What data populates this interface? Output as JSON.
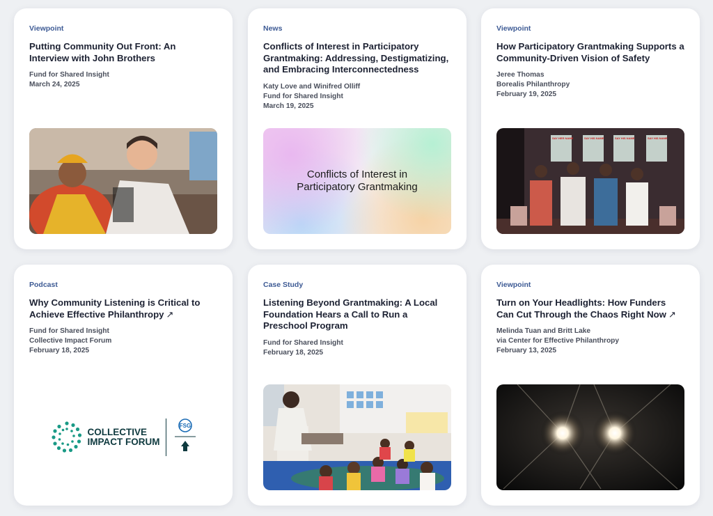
{
  "cards": [
    {
      "category": "Viewpoint",
      "title": "Putting Community Out Front: An Interview with John Brothers",
      "external": "",
      "meta": [
        "Fund for Shared Insight",
        "March 24, 2025"
      ]
    },
    {
      "category": "News",
      "title": "Conflicts of Interest in Participatory Grantmaking: Addressing, Destigmatizing, and Embracing Interconnectedness",
      "external": "",
      "meta": [
        "Katy Love and Winifred Olliff",
        "Fund for Shared Insight",
        "March 19, 2025"
      ],
      "image_text": "Conflicts of Interest in Participatory Grantmaking"
    },
    {
      "category": "Viewpoint",
      "title": "How Participatory Grantmaking Supports a Community-Driven Vision of Safety",
      "external": "",
      "meta": [
        "Jeree Thomas",
        "Borealis Philanthropy",
        "February 19, 2025"
      ],
      "poster_text": [
        "SAY HER NAME",
        "SAY HIS NAME",
        "SAY HIS NAME",
        "SAY HIS NAME"
      ]
    },
    {
      "category": "Podcast",
      "title": "Why Community Listening is Critical to Achieve Effective Philanthropy",
      "external": "↗",
      "meta": [
        "Fund for Shared Insight",
        "Collective Impact Forum",
        "February 18, 2025"
      ],
      "logo": {
        "line1": "COLLECTIVE",
        "line2": "IMPACT FORUM",
        "badge": "FSG"
      }
    },
    {
      "category": "Case Study",
      "title": "Listening Beyond Grantmaking: A Local Foundation Hears a Call to Run a Preschool Program",
      "external": "",
      "meta": [
        "Fund for Shared Insight",
        "February 18, 2025"
      ]
    },
    {
      "category": "Viewpoint",
      "title": "Turn on Your Headlights: How Funders Can Cut Through the Chaos Right Now",
      "external": "↗",
      "meta": [
        "Melinda Tuan and Britt Lake",
        "via Center for Effective Philanthropy",
        "February 13, 2025"
      ]
    }
  ],
  "colors": {
    "category": "#3d5a94",
    "title": "#1d2233",
    "meta": "#4a4f5c",
    "logo_teal": "#1a9a86"
  }
}
